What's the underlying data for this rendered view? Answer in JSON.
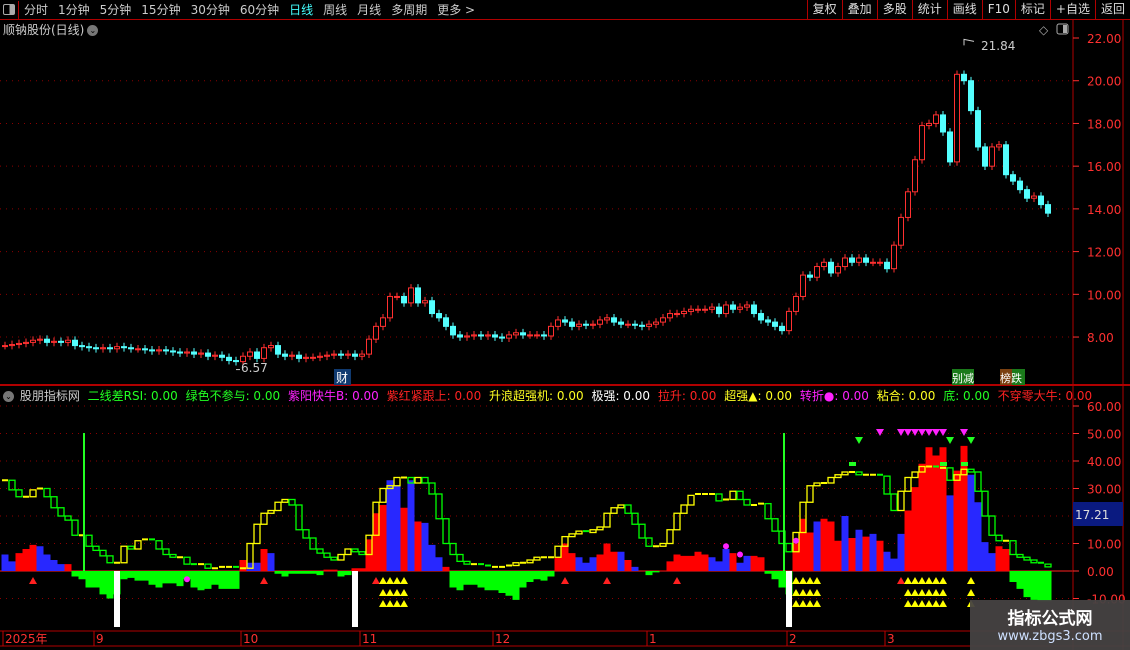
{
  "toolbar": {
    "periods": [
      "分时",
      "1分钟",
      "5分钟",
      "15分钟",
      "30分钟",
      "60分钟",
      "日线",
      "周线",
      "月线",
      "多周期",
      "更多 >"
    ],
    "active_period": "日线",
    "buttons": [
      "复权",
      "叠加",
      "多股",
      "统计",
      "画线",
      "F10",
      "标记",
      "+自选",
      "返回"
    ]
  },
  "chart": {
    "title": "顺钠股份(日线)",
    "high_label": "21.84",
    "low_label": "6.57",
    "event_tags": [
      "财",
      "别减",
      "榜跌"
    ],
    "price_axis": [
      "22.00",
      "20.00",
      "18.00",
      "16.00",
      "14.00",
      "12.00",
      "10.00",
      "8.00"
    ],
    "colors": {
      "up": "#ff3030",
      "down": "#54ffff",
      "grid": "#8b0000",
      "axis": "#ff3030"
    },
    "close": [
      7.6,
      7.65,
      7.7,
      7.75,
      7.85,
      7.9,
      7.75,
      7.8,
      7.75,
      7.85,
      7.6,
      7.55,
      7.5,
      7.45,
      7.5,
      7.45,
      7.55,
      7.5,
      7.45,
      7.45,
      7.4,
      7.35,
      7.4,
      7.35,
      7.3,
      7.25,
      7.3,
      7.2,
      7.25,
      7.1,
      7.15,
      7.05,
      6.9,
      6.85,
      7.1,
      7.3,
      7.0,
      7.5,
      7.6,
      7.2,
      7.1,
      7.15,
      7.0,
      7.05,
      7.05,
      7.1,
      7.15,
      7.2,
      7.15,
      7.2,
      7.1,
      7.2,
      7.9,
      8.5,
      8.9,
      9.9,
      9.9,
      9.6,
      10.3,
      9.6,
      9.7,
      9.1,
      8.9,
      8.5,
      8.1,
      8.0,
      8.05,
      8.1,
      8.05,
      8.1,
      8.0,
      7.95,
      8.1,
      8.2,
      8.1,
      8.1,
      8.1,
      8.05,
      8.5,
      8.8,
      8.7,
      8.5,
      8.6,
      8.55,
      8.6,
      8.8,
      8.9,
      8.7,
      8.6,
      8.6,
      8.55,
      8.5,
      8.6,
      8.7,
      8.9,
      9.1,
      9.1,
      9.2,
      9.3,
      9.3,
      9.3,
      9.4,
      9.1,
      9.5,
      9.3,
      9.4,
      9.5,
      9.1,
      8.8,
      8.7,
      8.5,
      8.3,
      9.2,
      9.9,
      10.9,
      10.8,
      11.3,
      11.5,
      11.0,
      11.3,
      11.7,
      11.5,
      11.7,
      11.5,
      11.5,
      11.5,
      11.2,
      12.3,
      13.6,
      14.8,
      16.3,
      17.9,
      18.0,
      18.4,
      17.6,
      16.2,
      20.3,
      20.0,
      18.6,
      16.9,
      16.0,
      16.9,
      17.0,
      15.6,
      15.3,
      14.9,
      14.5,
      14.6,
      14.2,
      13.8
    ]
  },
  "indicator": {
    "name": "股朋指标网",
    "fields": [
      {
        "label": "二线差RSI: 0.00",
        "color": "#22ff22"
      },
      {
        "label": "绿色不参与: 0.00",
        "color": "#22ff22"
      },
      {
        "label": "紫阳快牛B: 0.00",
        "color": "#ff22ff"
      },
      {
        "label": "紫红紧跟上: 0.00",
        "color": "#ff2222"
      },
      {
        "label": "升浪超强机: 0.00",
        "color": "#ffff22"
      },
      {
        "label": "极强: 0.00",
        "color": "#ffffff"
      },
      {
        "label": "拉升: 0.00",
        "color": "#ff2222"
      },
      {
        "label": "超强▲: 0.00",
        "color": "#ffff22"
      },
      {
        "label": "转折●: 0.00",
        "color": "#ff22ff"
      },
      {
        "label": "粘合: 0.00",
        "color": "#ffff22"
      },
      {
        "label": "底: 0.00",
        "color": "#22ff22"
      },
      {
        "label": "不穿零大牛: 0.00",
        "color": "#ff2222"
      }
    ],
    "axis": [
      "60.00",
      "50.00",
      "40.00",
      "30.00",
      "20.00",
      "10.00",
      "0.00",
      "-10.00"
    ],
    "current_value": "17.21",
    "histogram": [
      6,
      3.5,
      6.5,
      8,
      9.5,
      9,
      6,
      4,
      2.5,
      2.5,
      -2,
      -3,
      -6,
      -6,
      -8.5,
      -10,
      -8.5,
      -3,
      -2.5,
      -3.5,
      -3.5,
      -5,
      -6,
      -4.5,
      -4.5,
      -5.5,
      -3,
      -6,
      -7,
      -6.5,
      -5,
      -6.5,
      -6.5,
      -6.5,
      4,
      3,
      3,
      8,
      6.5,
      -1,
      -2,
      -1,
      -1,
      -1,
      -1,
      -1.5,
      0.5,
      0.5,
      -2,
      -1.5,
      1,
      1,
      11.5,
      21,
      24,
      33,
      31,
      23,
      33,
      18,
      17.5,
      9.5,
      5,
      1.5,
      -6,
      -7,
      -5,
      -5,
      -6,
      -7,
      -7,
      -8,
      -9,
      -10.5,
      -6,
      -4,
      -3,
      -3.5,
      -2,
      5,
      10,
      6.5,
      5,
      3,
      5,
      6,
      10,
      7,
      7,
      4,
      1.5,
      0,
      -1.5,
      -0.5,
      0.2,
      3.5,
      6,
      5.5,
      5.5,
      7,
      6,
      5,
      3.5,
      8,
      6.5,
      3,
      5.5,
      5.5,
      5,
      -1,
      -3,
      -6,
      -8.5,
      10,
      19,
      14,
      18,
      19,
      18,
      11,
      20,
      12,
      15,
      12.5,
      13.5,
      11,
      7,
      4.5,
      13.5,
      22,
      30.5,
      39,
      45,
      42,
      45,
      27.5,
      36.5,
      45.5,
      35,
      25,
      10.5,
      6.5,
      9,
      8,
      -4,
      -6.5,
      -9.5,
      -10.5,
      -11,
      -11
    ],
    "histogram_colors": "bbrrrbbbbr000000000000000000000000rbbrb0000000000rrrrrrbbrbrbbb00000000000000000rrbbbrrrbrbb0000rrrrrbbbrbbrrr0000rrbrrrbrbrbrbbbrrrrrrbrrbbbbrr000000",
    "line": [
      33,
      29.5,
      27,
      27,
      29.5,
      30,
      27,
      23,
      20,
      18.5,
      13,
      13,
      9,
      7.5,
      5.5,
      3,
      3,
      9,
      8,
      11,
      11.5,
      11,
      8,
      6,
      5,
      5,
      2.5,
      2,
      2.5,
      1,
      1,
      1.5,
      1.5,
      0.8,
      1,
      10,
      17,
      21,
      22,
      25,
      26,
      24,
      15,
      12,
      8,
      6.5,
      5,
      4,
      6,
      8,
      7,
      6,
      13,
      25,
      30,
      31,
      34,
      34,
      32,
      34,
      32,
      28,
      19,
      10,
      6,
      3.5,
      2.5,
      2.5,
      2,
      1.5,
      1.5,
      1.5,
      2,
      3,
      3,
      4,
      5,
      5,
      5,
      9,
      12.5,
      13.5,
      14.5,
      14,
      15,
      16,
      21,
      23,
      24,
      21,
      17,
      12,
      9,
      9,
      10,
      15,
      21,
      24,
      27.5,
      28,
      28,
      28,
      25.5,
      26,
      29,
      26,
      24,
      24,
      24.5,
      19,
      14.5,
      10,
      7,
      14,
      25,
      31,
      32,
      32,
      34,
      35,
      36,
      36,
      35,
      35,
      35,
      34.5,
      28,
      22,
      29,
      34,
      36,
      38,
      38,
      37.5,
      37.5,
      33,
      35,
      37,
      36,
      29,
      20,
      13,
      11,
      11,
      6,
      5,
      4,
      3,
      2.5,
      1.5
    ],
    "markers": {
      "red_up_triangles": [
        4,
        37,
        53,
        80,
        86,
        96,
        128
      ],
      "yellow_triangle_stacks": [
        54,
        55,
        56,
        57,
        113,
        114,
        115,
        116,
        129,
        130,
        131,
        132,
        133,
        134,
        138
      ],
      "magenta_down_triangles": [
        125,
        128,
        129,
        130,
        131,
        132,
        133,
        134,
        137
      ],
      "green_down_triangles": [
        122,
        135,
        138
      ],
      "green_flags": [
        121,
        134,
        137
      ],
      "white_spikes": [
        16,
        50,
        112
      ],
      "green_vertical_lines": [
        11,
        111
      ],
      "magenta_dots": [
        [
          26,
          -3
        ],
        [
          103,
          9
        ],
        [
          105,
          6
        ],
        [
          113,
          11
        ]
      ]
    }
  },
  "time_axis": [
    {
      "label": "2025年",
      "bar": 0
    },
    {
      "label": "9",
      "bar": 13
    },
    {
      "label": "10",
      "bar": 34
    },
    {
      "label": "11",
      "bar": 51
    },
    {
      "label": "12",
      "bar": 70
    },
    {
      "label": "1",
      "bar": 92
    },
    {
      "label": "2",
      "bar": 112
    },
    {
      "label": "3",
      "bar": 126
    }
  ],
  "watermark": {
    "title": "指标公式网",
    "url": "www.zbgs3.com"
  }
}
